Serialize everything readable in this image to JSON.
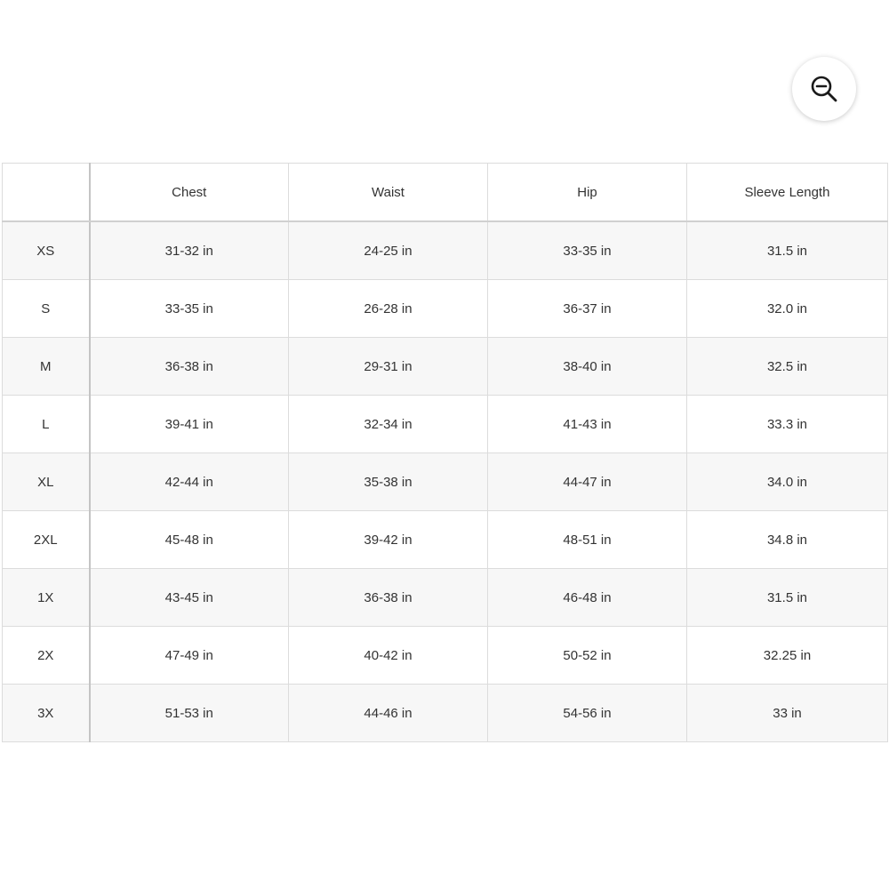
{
  "zoom": {
    "icon": "zoom-out-icon"
  },
  "table": {
    "headers": [
      "",
      "Chest",
      "Waist",
      "Hip",
      "Sleeve Length"
    ],
    "rows": [
      {
        "size": "XS",
        "chest": "31-32 in",
        "waist": "24-25 in",
        "hip": "33-35 in",
        "sleeve": "31.5 in"
      },
      {
        "size": "S",
        "chest": "33-35 in",
        "waist": "26-28 in",
        "hip": "36-37 in",
        "sleeve": "32.0 in"
      },
      {
        "size": "M",
        "chest": "36-38 in",
        "waist": "29-31 in",
        "hip": "38-40 in",
        "sleeve": "32.5 in"
      },
      {
        "size": "L",
        "chest": "39-41 in",
        "waist": "32-34 in",
        "hip": "41-43 in",
        "sleeve": "33.3 in"
      },
      {
        "size": "XL",
        "chest": "42-44 in",
        "waist": "35-38 in",
        "hip": "44-47 in",
        "sleeve": "34.0 in"
      },
      {
        "size": "2XL",
        "chest": "45-48 in",
        "waist": "39-42 in",
        "hip": "48-51 in",
        "sleeve": "34.8 in"
      },
      {
        "size": "1X",
        "chest": "43-45 in",
        "waist": "36-38 in",
        "hip": "46-48 in",
        "sleeve": "31.5 in"
      },
      {
        "size": "2X",
        "chest": "47-49 in",
        "waist": "40-42 in",
        "hip": "50-52 in",
        "sleeve": "32.25 in"
      },
      {
        "size": "3X",
        "chest": "51-53 in",
        "waist": "44-46 in",
        "hip": "54-56 in",
        "sleeve": "33 in"
      }
    ]
  }
}
